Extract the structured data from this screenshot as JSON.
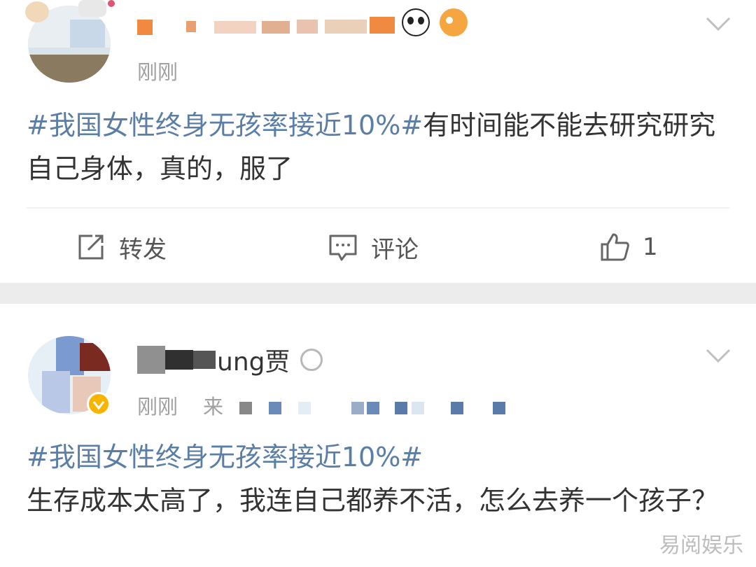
{
  "post1": {
    "time": "刚刚",
    "hashtag": "#我国女性终身无孩率接近10%#",
    "text": "有时间能不能去研究研究自己身体，真的，服了",
    "actions": {
      "repost_label": "转发",
      "comment_label": "评论",
      "like_count": "1"
    }
  },
  "post2": {
    "name_suffix": "ung贾",
    "time": "刚刚",
    "source_prefix": "来",
    "hashtag": "#我国女性终身无孩率接近10%#",
    "text": "生存成本太高了，我连自己都养不活，怎么去养一个孩子？"
  },
  "watermark": "易阅娱乐",
  "colors": {
    "hashtag": "#5a7ea6",
    "text": "#333333",
    "muted": "#a0a0a0",
    "separator": "#ececec",
    "verified_badge": "#f7b500"
  }
}
